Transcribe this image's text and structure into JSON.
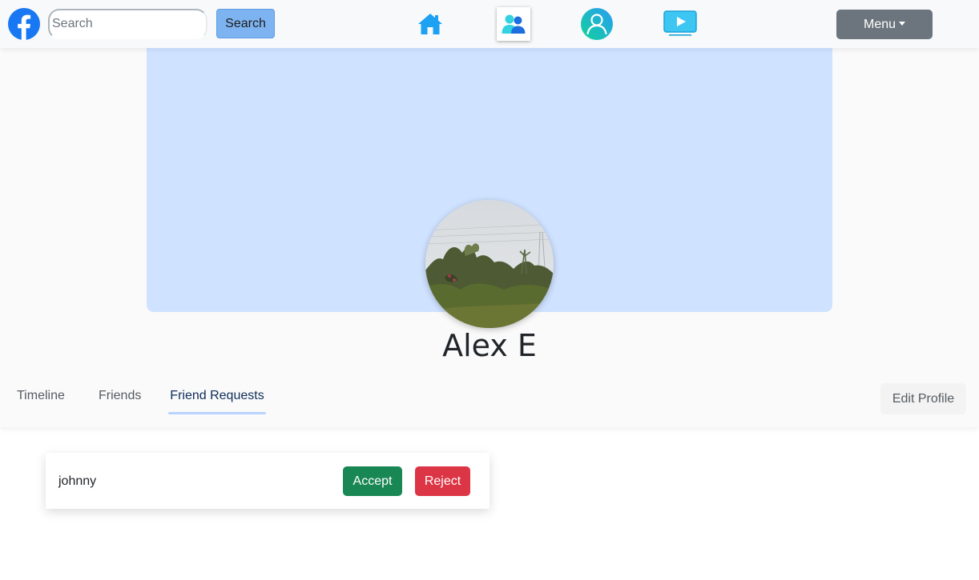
{
  "navbar": {
    "search_placeholder": "Search",
    "search_button": "Search",
    "menu_button": "Menu",
    "icons": [
      "facebook-logo",
      "home-icon",
      "friends-icon",
      "profile-icon",
      "watch-icon"
    ],
    "active_icon": "friends-icon"
  },
  "profile": {
    "name": "Alex E",
    "cover_color": "#cfe2ff"
  },
  "tabs": [
    {
      "label": "Timeline",
      "active": false
    },
    {
      "label": "Friends",
      "active": false
    },
    {
      "label": "Friend Requests",
      "active": true
    }
  ],
  "edit_profile_label": "Edit Profile",
  "friend_requests": [
    {
      "name": "johnny",
      "accept_label": "Accept",
      "reject_label": "Reject"
    }
  ],
  "colors": {
    "accent": "#1877f2",
    "accept": "#198754",
    "reject": "#dc3545",
    "menu": "#6c757d"
  }
}
